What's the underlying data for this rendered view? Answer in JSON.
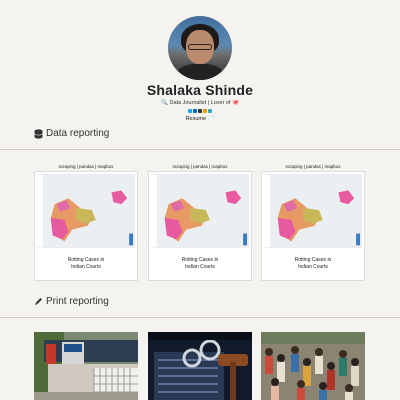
{
  "profile": {
    "name": "Shalaka Shinde",
    "tagline": "🔍 Data Journalist | Lover of 🐙",
    "resume": "Resume 📄"
  },
  "sections": [
    {
      "title": "Data reporting",
      "icon": "database-icon"
    },
    {
      "title": "Print reporting",
      "icon": "pen-icon"
    }
  ],
  "data_cards": [
    {
      "tags": "scraping | pandas | mapbox",
      "caption_line1": "Rotting Cases in",
      "caption_line2": "Indian Courts"
    },
    {
      "tags": "scraping | pandas | mapbox",
      "caption_line1": "Rotting Cases in",
      "caption_line2": "Indian Courts"
    },
    {
      "tags": "scraping | pandas | mapbox",
      "caption_line1": "Rotting Cases in",
      "caption_line2": "Indian Courts"
    }
  ],
  "colors": {
    "background": "#f4f3ef",
    "map_pink": "#e85aa0",
    "map_orange": "#e79a64",
    "map_yellow": "#c9b85a"
  }
}
